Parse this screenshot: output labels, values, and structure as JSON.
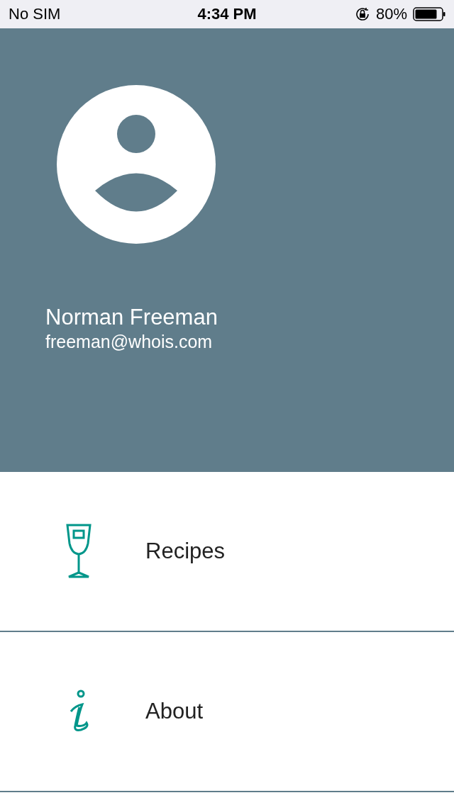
{
  "status_bar": {
    "carrier": "No SIM",
    "time": "4:34 PM",
    "battery_text": "80%"
  },
  "profile": {
    "name": "Norman Freeman",
    "email": "freeman@whois.com"
  },
  "menu": [
    {
      "kind": "glass",
      "label": "Recipes"
    },
    {
      "kind": "info",
      "label": "About"
    }
  ]
}
